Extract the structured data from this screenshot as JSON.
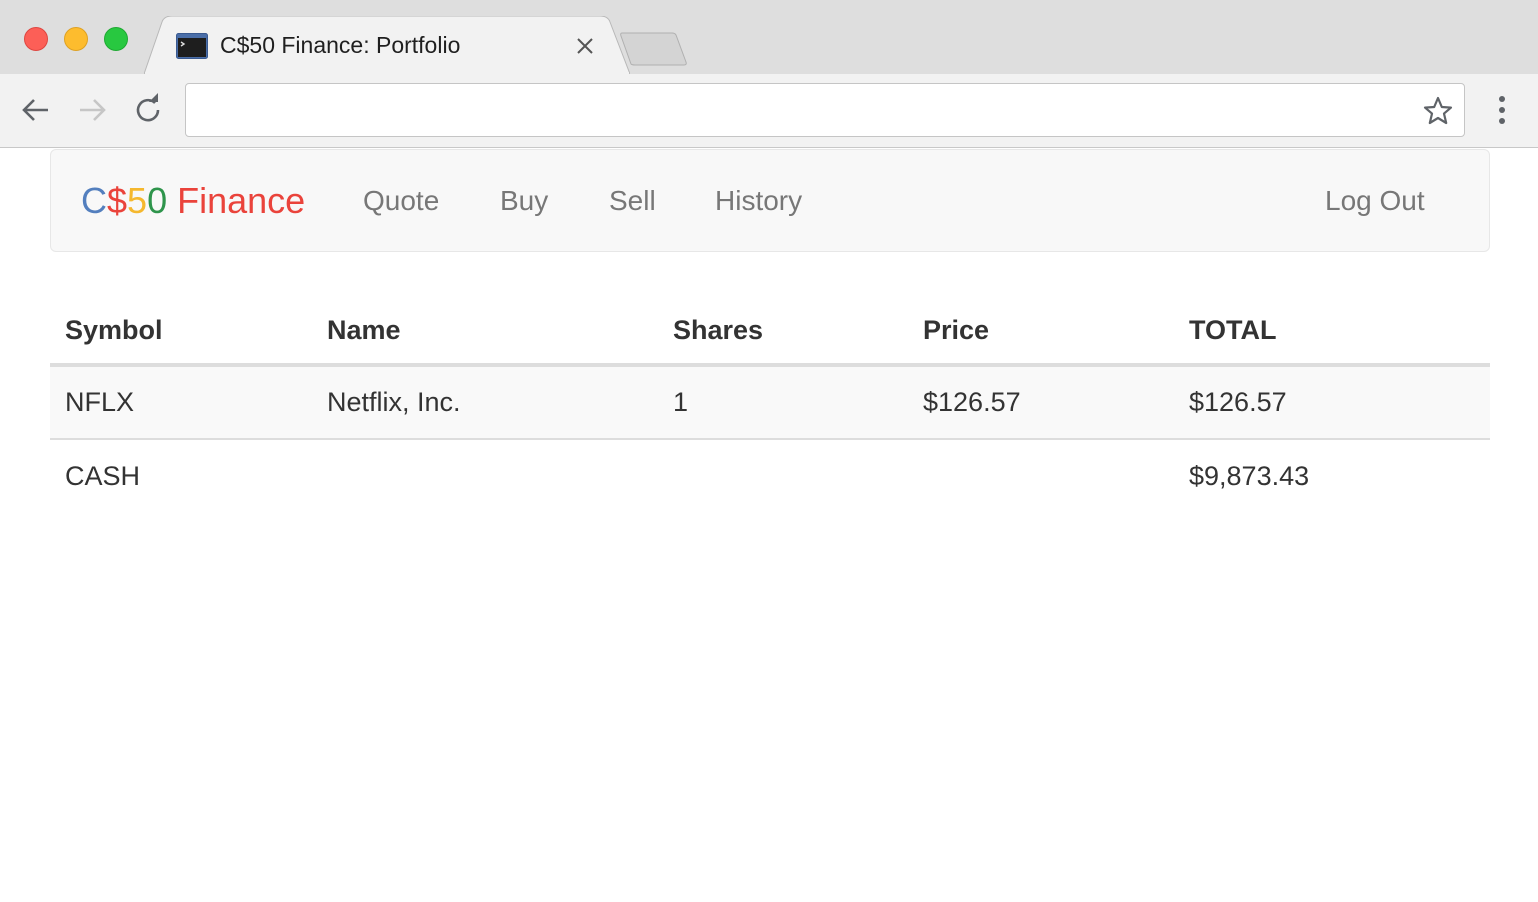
{
  "browser": {
    "tab_title": "C$50 Finance: Portfolio",
    "address": "",
    "icons": {
      "back": "arrow-left-icon",
      "forward": "arrow-right-icon",
      "reload": "reload-icon",
      "bookmark": "star-icon",
      "menu": "vertical-ellipsis-icon",
      "close_tab": "close-icon",
      "favicon": "terminal-icon"
    }
  },
  "navbar": {
    "brand": {
      "c": "C",
      "dollar": "$",
      "five": "5",
      "zero": "0",
      "finance": " Finance"
    },
    "links": [
      "Quote",
      "Buy",
      "Sell",
      "History"
    ],
    "logout": "Log Out",
    "brand_colors": {
      "blue": "#537fbe",
      "red": "#ea433b",
      "yellow": "#f5b82e",
      "green": "#2e944b"
    }
  },
  "portfolio": {
    "headers": [
      "Symbol",
      "Name",
      "Shares",
      "Price",
      "TOTAL"
    ],
    "rows": [
      {
        "symbol": "NFLX",
        "name": "Netflix, Inc.",
        "shares": "1",
        "price": "$126.57",
        "total": "$126.57"
      }
    ],
    "cash": {
      "label": "CASH",
      "total": "$9,873.43"
    }
  }
}
